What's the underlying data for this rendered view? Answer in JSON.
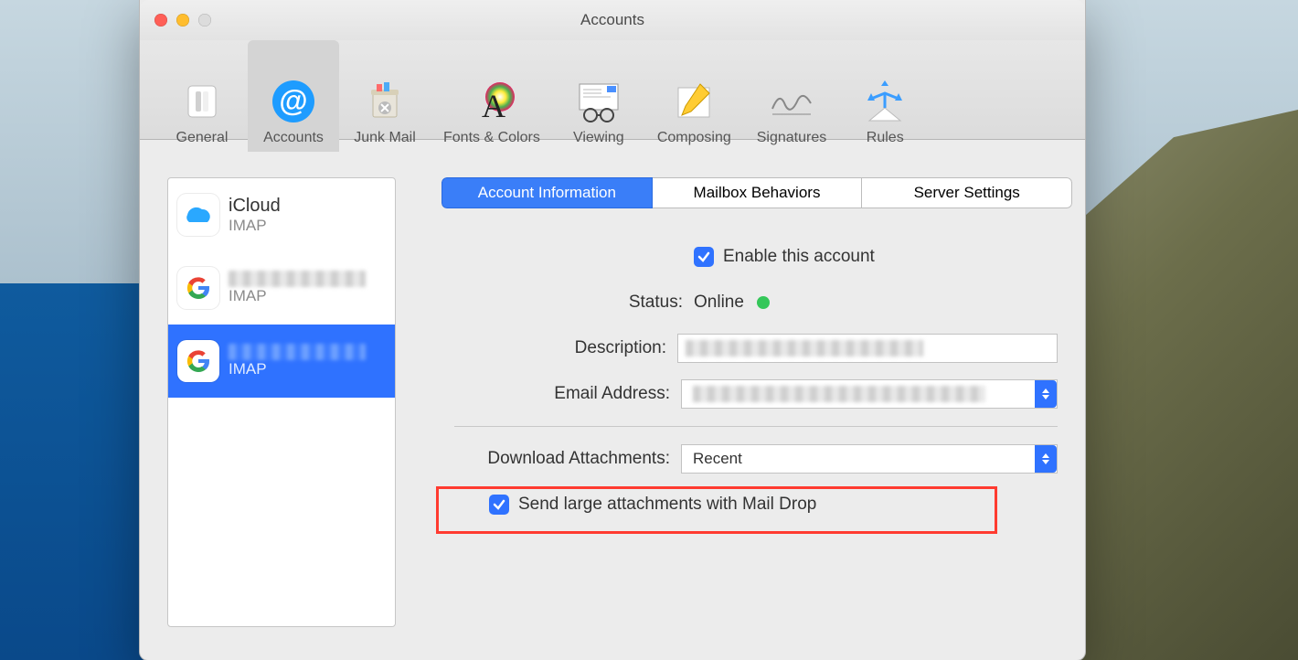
{
  "window": {
    "title": "Accounts"
  },
  "toolbar": {
    "general": {
      "label": "General"
    },
    "accounts": {
      "label": "Accounts"
    },
    "junk": {
      "label": "Junk Mail"
    },
    "fonts": {
      "label": "Fonts & Colors"
    },
    "viewing": {
      "label": "Viewing"
    },
    "composing": {
      "label": "Composing"
    },
    "signatures": {
      "label": "Signatures"
    },
    "rules": {
      "label": "Rules"
    }
  },
  "sidebar": {
    "accounts": [
      {
        "name": "iCloud",
        "type": "IMAP",
        "icon": "icloud",
        "selected": false
      },
      {
        "name": "",
        "type": "IMAP",
        "icon": "google",
        "selected": false
      },
      {
        "name": "",
        "type": "IMAP",
        "icon": "google",
        "selected": true
      }
    ]
  },
  "tabs": {
    "info": {
      "label": "Account Information"
    },
    "mailbox": {
      "label": "Mailbox Behaviors"
    },
    "server": {
      "label": "Server Settings"
    }
  },
  "form": {
    "enable_label": "Enable this account",
    "status_label": "Status:",
    "status_value": "Online",
    "description_label": "Description:",
    "email_label": "Email Address:",
    "download_label": "Download Attachments:",
    "download_value": "Recent",
    "maildrop_label": "Send large attachments with Mail Drop"
  },
  "colors": {
    "accent": "#2f72ff",
    "online": "#34c759"
  }
}
